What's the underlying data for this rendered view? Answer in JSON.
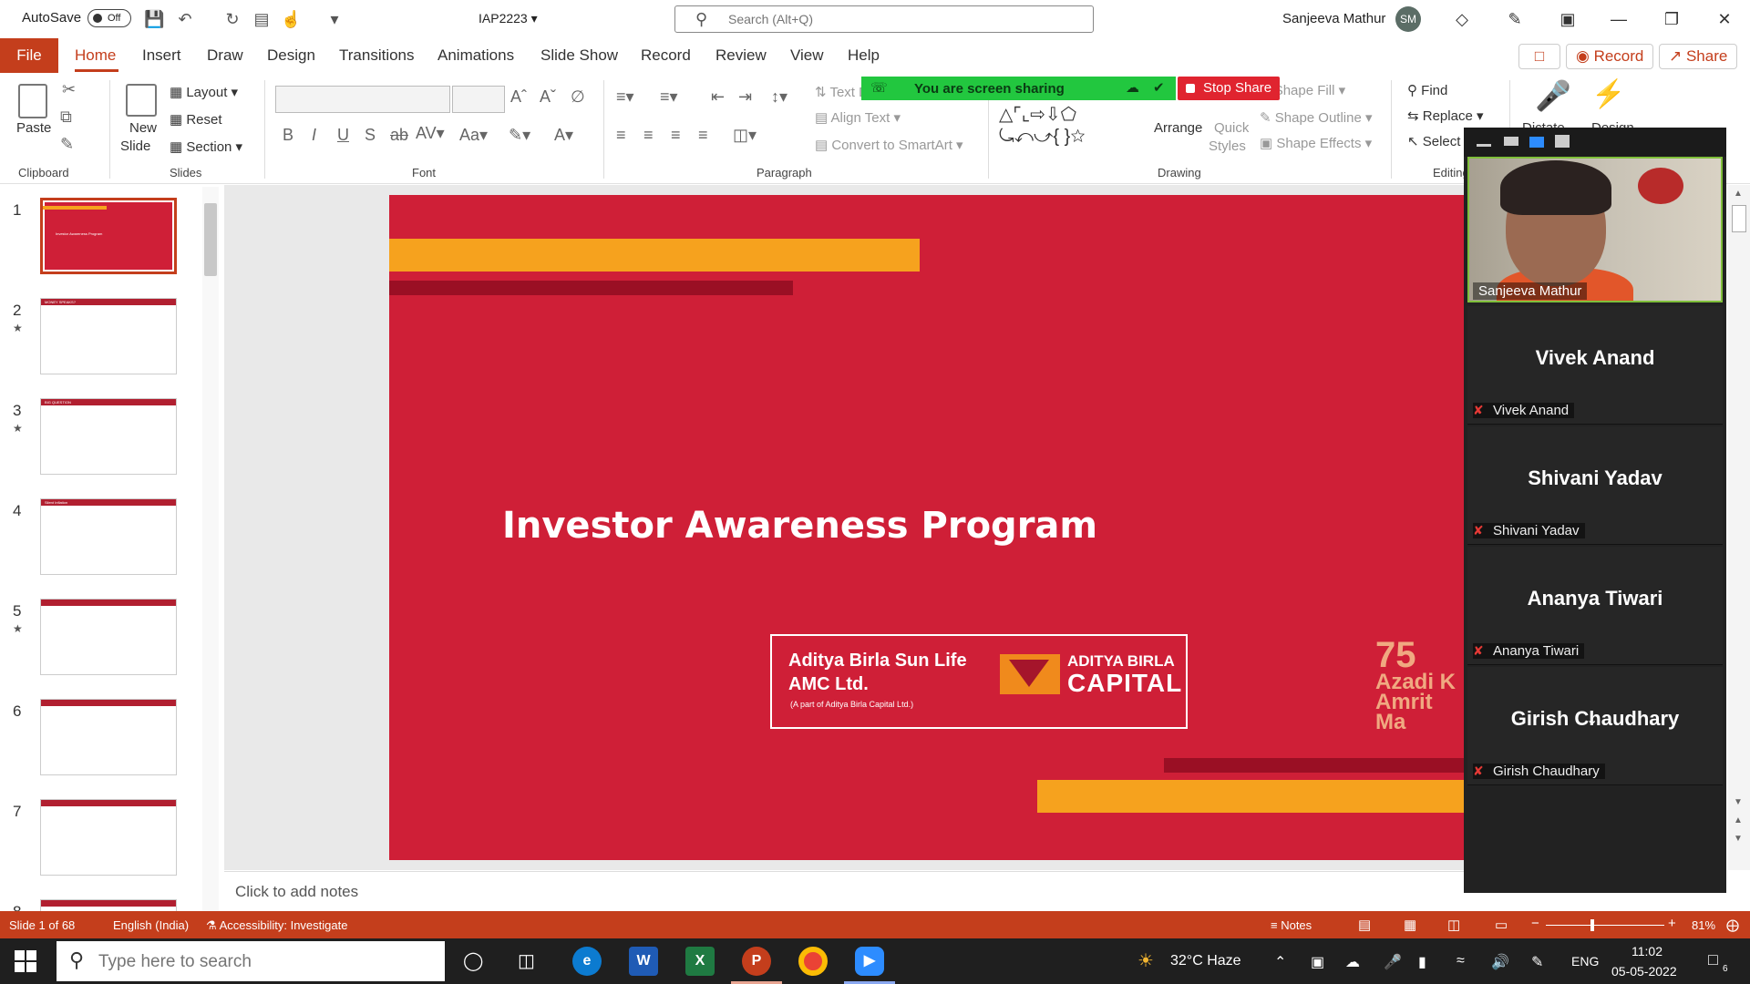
{
  "titlebar": {
    "autosave_label": "AutoSave",
    "autosave_state": "Off",
    "doc_name": "IAP2223",
    "search_placeholder": "Search (Alt+Q)",
    "user_name": "Sanjeeva Mathur",
    "user_initials": "SM"
  },
  "tabs": {
    "file": "File",
    "items": [
      "Home",
      "Insert",
      "Draw",
      "Design",
      "Transitions",
      "Animations",
      "Slide Show",
      "Record",
      "Review",
      "View",
      "Help"
    ],
    "record_btn": "Record",
    "share_btn": "Share"
  },
  "ribbon": {
    "clipboard": {
      "paste": "Paste",
      "label": "Clipboard"
    },
    "slides": {
      "new_slide_1": "New",
      "new_slide_2": "Slide",
      "layout": "Layout",
      "reset": "Reset",
      "section": "Section",
      "label": "Slides"
    },
    "font": {
      "label": "Font",
      "bold": "B",
      "italic": "I",
      "underline": "U",
      "strike": "S",
      "aa": "Aa"
    },
    "paragraph": {
      "label": "Paragraph",
      "text_direction": "Text Direction",
      "align_text": "Align Text",
      "smartart": "Convert to SmartArt"
    },
    "drawing": {
      "label": "Drawing",
      "arrange": "Arrange",
      "quick_styles_1": "Quick",
      "quick_styles_2": "Styles",
      "shape_fill": "Shape Fill",
      "shape_outline": "Shape Outline",
      "shape_effects": "Shape Effects"
    },
    "editing": {
      "label": "Editing",
      "find": "Find",
      "replace": "Replace",
      "select": "Select"
    },
    "voice": {
      "dictate": "Dictate"
    },
    "designer": {
      "design": "Design"
    }
  },
  "screen_share": {
    "status": "You are screen sharing",
    "stop": "Stop Share"
  },
  "thumbnails": [
    {
      "num": "1",
      "star": false,
      "title": "Investor Awareness Program"
    },
    {
      "num": "2",
      "star": true,
      "title": "MONEY SPEAKS?"
    },
    {
      "num": "3",
      "star": true,
      "title": "BIG QUESTION"
    },
    {
      "num": "4",
      "star": false,
      "title": "Silent Inflation"
    },
    {
      "num": "5",
      "star": true,
      "title": ""
    },
    {
      "num": "6",
      "star": false,
      "title": ""
    },
    {
      "num": "7",
      "star": false,
      "title": ""
    },
    {
      "num": "8",
      "star": false,
      "title": ""
    }
  ],
  "slide": {
    "title": "Investor Awareness Program",
    "amc_line1": "Aditya Birla Sun Life",
    "amc_line2": "AMC Ltd.",
    "amc_line3": "(A part of Aditya Birla Capital Ltd.)",
    "brand_line1": "ADITYA BIRLA",
    "brand_line2": "CAPITAL",
    "azadi_1": "75",
    "azadi_2": "Azadi K",
    "azadi_3": "Amrit Ma"
  },
  "notes_placeholder": "Click to add notes",
  "zoom_panel": {
    "video_name": "Sanjeeva Mathur",
    "participants": [
      {
        "big": "Vivek Anand",
        "small": "Vivek Anand"
      },
      {
        "big": "Shivani Yadav",
        "small": "Shivani Yadav"
      },
      {
        "big": "Ananya Tiwari",
        "small": "Ananya Tiwari"
      },
      {
        "big": "Girish Chaudhary",
        "small": "Girish Chaudhary"
      }
    ]
  },
  "statusbar": {
    "slide_info": "Slide 1 of 68",
    "language": "English (India)",
    "accessibility": "Accessibility: Investigate",
    "notes": "Notes",
    "zoom": "81%",
    "zoom_fraction": 0.38
  },
  "taskbar": {
    "search_placeholder": "Type here to search",
    "weather": "32°C  Haze",
    "lang": "ENG",
    "time": "11:02",
    "date": "05-05-2022",
    "notif_count": "6"
  },
  "colors": {
    "accent": "#c43e1c",
    "slide_red": "#cf1f37",
    "slide_orange": "#f6a21e",
    "share_green": "#22c73f",
    "stop_red": "#e0242f"
  }
}
